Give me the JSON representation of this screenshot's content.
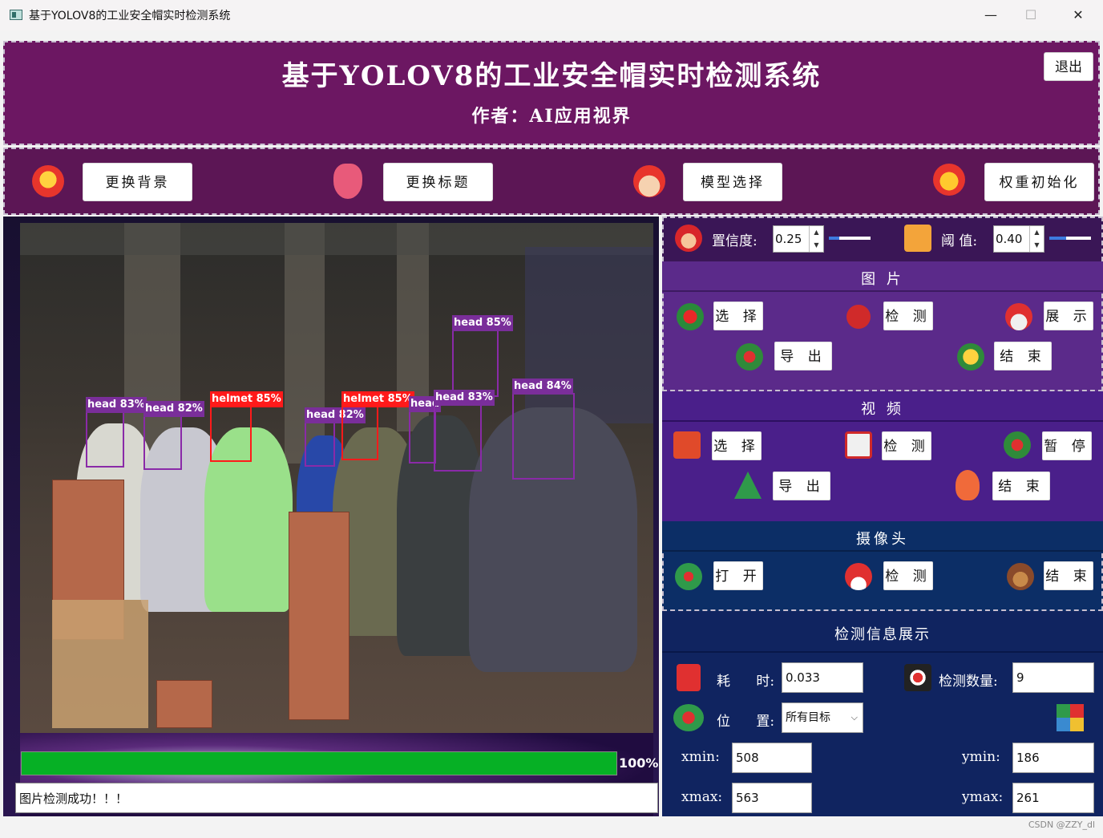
{
  "window": {
    "title": "基于YOLOV8的工业安全帽实时检测系统",
    "minimize": "—",
    "maximize": "☐",
    "close": "✕"
  },
  "header": {
    "title": "基于YOLOV8的工业安全帽实时检测系统",
    "subtitle": "作者：AI应用视界",
    "exit_label": "退出"
  },
  "toolbar": {
    "change_bg": "更换背景",
    "change_title": "更换标题",
    "model_select": "模型选择",
    "weight_init": "权重初始化"
  },
  "detections": [
    {
      "label": "head 83%",
      "cls": "head"
    },
    {
      "label": "head 82%",
      "cls": "head"
    },
    {
      "label": "helmet 85%",
      "cls": "helmet"
    },
    {
      "label": "head 82%",
      "cls": "head"
    },
    {
      "label": "helmet 85%",
      "cls": "helmet"
    },
    {
      "label": "head 85%",
      "cls": "head"
    },
    {
      "label": "head",
      "cls": "head"
    },
    {
      "label": "head 83%",
      "cls": "head"
    },
    {
      "label": "head 84%",
      "cls": "head"
    }
  ],
  "progress": {
    "value": 100,
    "label": "100%"
  },
  "status_text": "图片检测成功！！！",
  "params": {
    "conf_label": "置信度:",
    "conf_value": "0.25",
    "conf_slider": 0.25,
    "iou_label": "阈  值:",
    "iou_value": "0.40",
    "iou_slider": 0.4
  },
  "image_section": {
    "title": "图 片",
    "select": "选 择",
    "detect": "检 测",
    "show": "展 示",
    "export": "导 出",
    "end": "结 束"
  },
  "video_section": {
    "title": "视 频",
    "select": "选 择",
    "detect": "检 测",
    "pause": "暂 停",
    "export": "导 出",
    "end": "结 束"
  },
  "camera_section": {
    "title": "摄像头",
    "open": "打 开",
    "detect": "检 测",
    "end": "结 束"
  },
  "info_section": {
    "title": "检测信息展示",
    "time_label": "耗      时:",
    "time_value": "0.033",
    "count_label": "检测数量:",
    "count_value": "9",
    "pos_label": "位      置:",
    "pos_value": "所有目标",
    "xmin_label": "xmin:",
    "xmin_value": "508",
    "ymin_label": "ymin:",
    "ymin_value": "186",
    "xmax_label": "xmax:",
    "xmax_value": "563",
    "ymax_label": "ymax:",
    "ymax_value": "261"
  },
  "watermark": "CSDN @ZZY_dl",
  "colors": {
    "header_bg": "#6c1762",
    "toolbar_bg": "#5c1655",
    "image_panel_bg": "#5b2a8a",
    "video_panel_bg": "#4a1f8a",
    "camera_panel_bg": "#0c2e66",
    "info_panel_bg": "#102460",
    "progress_fill": "#06b025",
    "det_head": "#8a2aa8",
    "det_helmet": "#ff1a1a"
  }
}
